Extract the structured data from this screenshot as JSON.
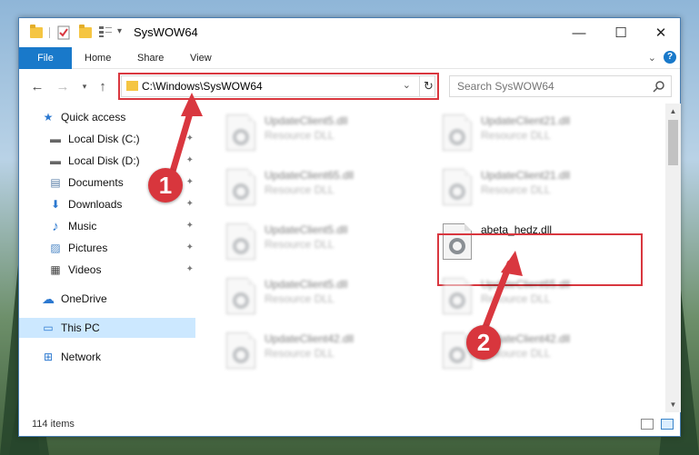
{
  "window": {
    "title": "SysWOW64",
    "controls": {
      "minimize": "—",
      "maximize": "☐",
      "close": "✕"
    }
  },
  "ribbon": {
    "tabs": [
      {
        "label": "File"
      },
      {
        "label": "Home"
      },
      {
        "label": "Share"
      },
      {
        "label": "View"
      }
    ],
    "expand_chevron": "⌄",
    "help": "?"
  },
  "address": {
    "path": "C:\\Windows\\SysWOW64",
    "search_placeholder": "Search SysWOW64"
  },
  "sidebar": {
    "items": [
      {
        "label": "Quick access",
        "icon": "star-icon",
        "glyph": "★"
      },
      {
        "label": "Local Disk (C:)",
        "icon": "drive-icon",
        "glyph": "▬",
        "pinned": true
      },
      {
        "label": "Local Disk (D:)",
        "icon": "drive-icon",
        "glyph": "▬",
        "pinned": true
      },
      {
        "label": "Documents",
        "icon": "documents-icon",
        "glyph": "▤",
        "pinned": true
      },
      {
        "label": "Downloads",
        "icon": "download-icon",
        "glyph": "⬇",
        "pinned": true
      },
      {
        "label": "Music",
        "icon": "music-icon",
        "glyph": "♪",
        "pinned": true
      },
      {
        "label": "Pictures",
        "icon": "pictures-icon",
        "glyph": "▨",
        "pinned": true
      },
      {
        "label": "Videos",
        "icon": "videos-icon",
        "glyph": "▦",
        "pinned": true
      },
      {
        "label": "OneDrive",
        "icon": "cloud-icon",
        "glyph": "☁"
      },
      {
        "label": "This PC",
        "icon": "computer-icon",
        "glyph": "▭",
        "selected": true
      },
      {
        "label": "Network",
        "icon": "network-icon",
        "glyph": "⊞"
      }
    ]
  },
  "files": [
    {
      "name": "UpdateClient5.dll",
      "type": "Resource DLL",
      "blurred": true
    },
    {
      "name": "UpdateClient21.dll",
      "type": "Resource DLL",
      "blurred": true
    },
    {
      "name": "UpdateClient65.dll",
      "type": "Resource DLL",
      "blurred": true
    },
    {
      "name": "UpdateClient21.dll",
      "type": "Resource DLL",
      "blurred": true
    },
    {
      "name": "UpdateClient5.dll",
      "type": "Resource DLL",
      "blurred": true
    },
    {
      "name": "abeta_hedz.dll",
      "type": "",
      "blurred": false
    },
    {
      "name": "UpdateClient5.dll",
      "type": "Resource DLL",
      "blurred": true
    },
    {
      "name": "UpdateClient65.dll",
      "type": "Resource DLL",
      "blurred": true
    },
    {
      "name": "UpdateClient42.dll",
      "type": "Resource DLL",
      "blurred": true
    },
    {
      "name": "UpdateClient42.dll",
      "type": "Resource DLL",
      "blurred": true
    }
  ],
  "status": {
    "item_count": "114 items"
  },
  "callouts": [
    {
      "label": "1"
    },
    {
      "label": "2"
    }
  ],
  "colors": {
    "accent": "#1979ca",
    "highlight": "#d9373f",
    "selected": "#cce8ff"
  }
}
